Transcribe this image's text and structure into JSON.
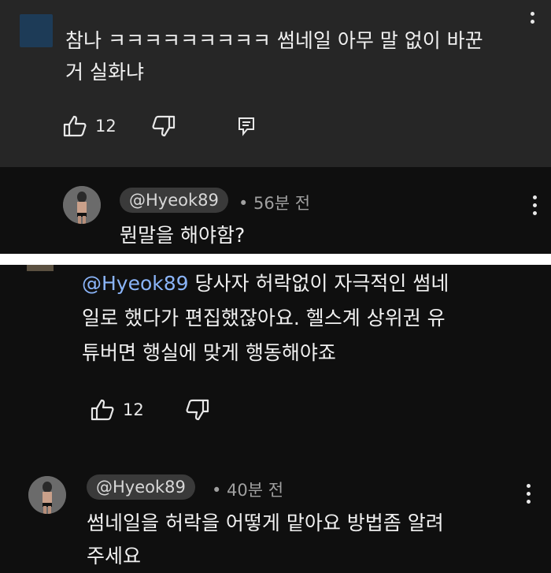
{
  "comment_top": {
    "text_line1": "참나 ㅋㅋㅋㅋㅋㅋㅋㅋㅋ 썸네일 아무 말 없이 바꾼",
    "text_line2": "거 실화냐",
    "like_count": "12"
  },
  "reply_1": {
    "handle": "@Hyeok89",
    "time": "• 56분 전",
    "text": "뭔말을 해야함?"
  },
  "comment_middle": {
    "mention": "@Hyeok89",
    "text_line1_rest": " 당사자 허락없이 자극적인 썸네",
    "text_line2": "일로 했다가 편집했잖아요. 헬스계 상위권 유",
    "text_line3": "튜버면 행실에 맞게 행동해야죠",
    "like_count": "12"
  },
  "reply_2": {
    "handle": "@Hyeok89",
    "time": "• 40분 전",
    "text_line1": "썸네일을 허락을 어떻게 맡아요 방법좀 알려",
    "text_line2": "주세요"
  },
  "icons": [
    "thumbs-up-icon",
    "thumbs-down-icon",
    "reply-icon",
    "more-options-icon"
  ]
}
